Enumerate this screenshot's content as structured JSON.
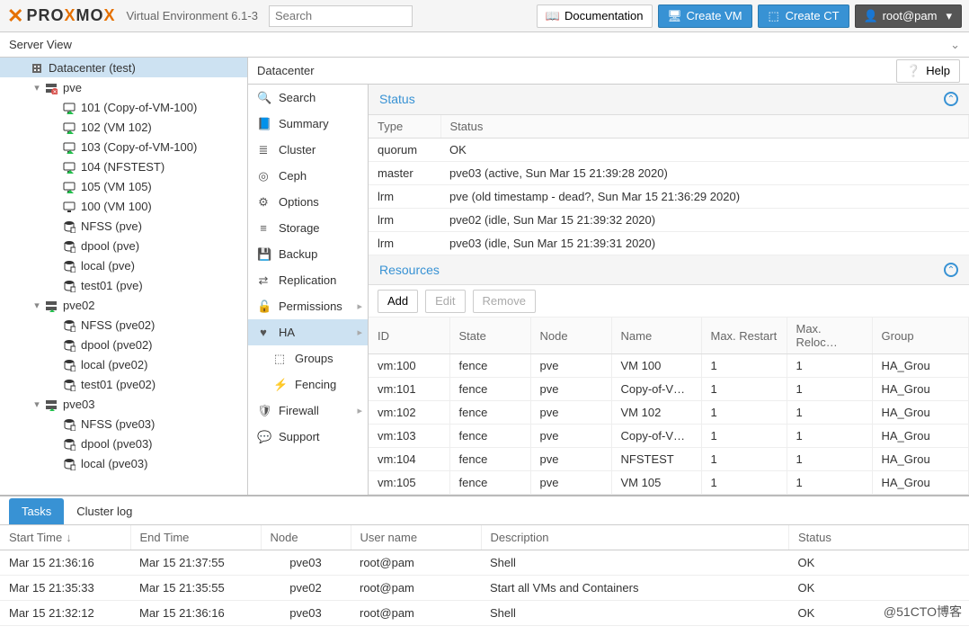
{
  "top": {
    "brand": "PROXMOX",
    "version": "Virtual Environment 6.1-3",
    "search_placeholder": "Search",
    "doc": "Documentation",
    "create_vm": "Create VM",
    "create_ct": "Create CT",
    "user": "root@pam"
  },
  "server_view_label": "Server View",
  "tree": [
    {
      "indent": 1,
      "arrow": "",
      "icon": "building",
      "iconcls": "gray",
      "label": "Datacenter (test)",
      "sel": true
    },
    {
      "indent": 2,
      "arrow": "▾",
      "icon": "server-bad",
      "iconcls": "red",
      "label": "pve"
    },
    {
      "indent": 3,
      "arrow": "",
      "icon": "monitor-on",
      "iconcls": "green",
      "label": "101 (Copy-of-VM-100)"
    },
    {
      "indent": 3,
      "arrow": "",
      "icon": "monitor-on",
      "iconcls": "green",
      "label": "102 (VM 102)"
    },
    {
      "indent": 3,
      "arrow": "",
      "icon": "monitor-on",
      "iconcls": "green",
      "label": "103 (Copy-of-VM-100)"
    },
    {
      "indent": 3,
      "arrow": "",
      "icon": "monitor-on",
      "iconcls": "green",
      "label": "104 (NFSTEST)"
    },
    {
      "indent": 3,
      "arrow": "",
      "icon": "monitor-on",
      "iconcls": "green",
      "label": "105 (VM 105)"
    },
    {
      "indent": 3,
      "arrow": "",
      "icon": "monitor-off",
      "iconcls": "gray",
      "label": "100 (VM 100)"
    },
    {
      "indent": 3,
      "arrow": "",
      "icon": "db",
      "iconcls": "db",
      "label": "NFSS (pve)"
    },
    {
      "indent": 3,
      "arrow": "",
      "icon": "db",
      "iconcls": "db",
      "label": "dpool (pve)"
    },
    {
      "indent": 3,
      "arrow": "",
      "icon": "db",
      "iconcls": "db",
      "label": "local (pve)"
    },
    {
      "indent": 3,
      "arrow": "",
      "icon": "db",
      "iconcls": "db",
      "label": "test01 (pve)"
    },
    {
      "indent": 2,
      "arrow": "▾",
      "icon": "server-good",
      "iconcls": "green",
      "label": "pve02"
    },
    {
      "indent": 3,
      "arrow": "",
      "icon": "db",
      "iconcls": "db",
      "label": "NFSS (pve02)"
    },
    {
      "indent": 3,
      "arrow": "",
      "icon": "db",
      "iconcls": "db",
      "label": "dpool (pve02)"
    },
    {
      "indent": 3,
      "arrow": "",
      "icon": "db",
      "iconcls": "db",
      "label": "local (pve02)"
    },
    {
      "indent": 3,
      "arrow": "",
      "icon": "db",
      "iconcls": "db",
      "label": "test01 (pve02)"
    },
    {
      "indent": 2,
      "arrow": "▾",
      "icon": "server-good",
      "iconcls": "green",
      "label": "pve03"
    },
    {
      "indent": 3,
      "arrow": "",
      "icon": "db",
      "iconcls": "db",
      "label": "NFSS (pve03)"
    },
    {
      "indent": 3,
      "arrow": "",
      "icon": "db",
      "iconcls": "db",
      "label": "dpool (pve03)"
    },
    {
      "indent": 3,
      "arrow": "",
      "icon": "db",
      "iconcls": "db",
      "label": "local (pve03)"
    }
  ],
  "content_title": "Datacenter",
  "help_label": "Help",
  "sidemenu": [
    {
      "icon": "🔍",
      "label": "Search"
    },
    {
      "icon": "📘",
      "label": "Summary"
    },
    {
      "icon": "≣",
      "label": "Cluster"
    },
    {
      "icon": "◎",
      "label": "Ceph"
    },
    {
      "icon": "⚙",
      "label": "Options"
    },
    {
      "icon": "≡",
      "label": "Storage"
    },
    {
      "icon": "💾",
      "label": "Backup"
    },
    {
      "icon": "⇄",
      "label": "Replication"
    },
    {
      "icon": "🔓",
      "label": "Permissions",
      "chev": true
    },
    {
      "icon": "♥",
      "label": "HA",
      "sel": true,
      "chev": true
    },
    {
      "icon": "⬚",
      "label": "Groups",
      "sub": true
    },
    {
      "icon": "⚡",
      "label": "Fencing",
      "sub": true
    },
    {
      "icon": "🛡",
      "label": "Firewall",
      "chev": true
    },
    {
      "icon": "💬",
      "label": "Support"
    }
  ],
  "status": {
    "title": "Status",
    "headers": {
      "type": "Type",
      "status": "Status"
    },
    "rows": [
      {
        "type": "quorum",
        "status": "OK"
      },
      {
        "type": "master",
        "status": "pve03 (active, Sun Mar 15 21:39:28 2020)"
      },
      {
        "type": "lrm",
        "status": "pve (old timestamp - dead?, Sun Mar 15 21:36:29 2020)"
      },
      {
        "type": "lrm",
        "status": "pve02 (idle, Sun Mar 15 21:39:32 2020)"
      },
      {
        "type": "lrm",
        "status": "pve03 (idle, Sun Mar 15 21:39:31 2020)"
      }
    ]
  },
  "resources": {
    "title": "Resources",
    "buttons": {
      "add": "Add",
      "edit": "Edit",
      "remove": "Remove"
    },
    "headers": {
      "id": "ID",
      "state": "State",
      "node": "Node",
      "name": "Name",
      "maxr": "Max. Restart",
      "maxl": "Max. Reloc…",
      "group": "Group"
    },
    "rows": [
      {
        "id": "vm:100",
        "state": "fence",
        "node": "pve",
        "name": "VM 100",
        "maxr": "1",
        "maxl": "1",
        "group": "HA_Grou"
      },
      {
        "id": "vm:101",
        "state": "fence",
        "node": "pve",
        "name": "Copy-of-V…",
        "maxr": "1",
        "maxl": "1",
        "group": "HA_Grou"
      },
      {
        "id": "vm:102",
        "state": "fence",
        "node": "pve",
        "name": "VM 102",
        "maxr": "1",
        "maxl": "1",
        "group": "HA_Grou"
      },
      {
        "id": "vm:103",
        "state": "fence",
        "node": "pve",
        "name": "Copy-of-V…",
        "maxr": "1",
        "maxl": "1",
        "group": "HA_Grou"
      },
      {
        "id": "vm:104",
        "state": "fence",
        "node": "pve",
        "name": "NFSTEST",
        "maxr": "1",
        "maxl": "1",
        "group": "HA_Grou"
      },
      {
        "id": "vm:105",
        "state": "fence",
        "node": "pve",
        "name": "VM 105",
        "maxr": "1",
        "maxl": "1",
        "group": "HA_Grou"
      }
    ]
  },
  "log": {
    "tabs": {
      "tasks": "Tasks",
      "cluster": "Cluster log"
    },
    "headers": {
      "start": "Start Time",
      "end": "End Time",
      "node": "Node",
      "user": "User name",
      "desc": "Description",
      "status": "Status"
    },
    "rows": [
      {
        "start": "Mar 15 21:36:16",
        "end": "Mar 15 21:37:55",
        "node": "pve03",
        "user": "root@pam",
        "desc": "Shell",
        "status": "OK"
      },
      {
        "start": "Mar 15 21:35:33",
        "end": "Mar 15 21:35:55",
        "node": "pve02",
        "user": "root@pam",
        "desc": "Start all VMs and Containers",
        "status": "OK"
      },
      {
        "start": "Mar 15 21:32:12",
        "end": "Mar 15 21:36:16",
        "node": "pve03",
        "user": "root@pam",
        "desc": "Shell",
        "status": "OK"
      }
    ]
  },
  "watermark": "@51CTO博客"
}
